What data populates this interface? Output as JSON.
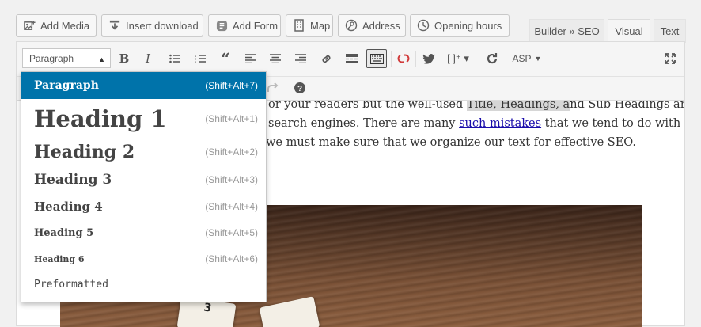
{
  "media_buttons": [
    {
      "label": "Add Media",
      "icon": "add-media-icon"
    },
    {
      "label": "Insert download",
      "icon": "download-icon"
    },
    {
      "label": "Add Form",
      "icon": "form-icon"
    },
    {
      "label": "Map",
      "icon": "map-icon"
    },
    {
      "label": "Address",
      "icon": "address-icon"
    },
    {
      "label": "Opening hours",
      "icon": "clock-icon"
    }
  ],
  "tabs": {
    "builder": "Builder » SEO",
    "visual": "Visual",
    "text": "Text"
  },
  "toolbar": {
    "format_select": "Paragraph",
    "asp_label": "ASP"
  },
  "content": {
    "line1_a": "or your readers but the well-used ",
    "line1_hl": "Title, Headings, a",
    "line1_b": "nd Sub Headings are",
    "line2_a": " search engines. There are many ",
    "line2_link": "such mistakes",
    "line2_b": " that we tend to do with",
    "line3": "we must make sure that we organize our text for effective SEO."
  },
  "photo": {
    "tile_a": "3"
  },
  "format_menu": [
    {
      "label": "Paragraph",
      "shortcut": "(Shift+Alt+7)",
      "active": true
    },
    {
      "label": "Heading 1",
      "shortcut": "(Shift+Alt+1)"
    },
    {
      "label": "Heading 2",
      "shortcut": "(Shift+Alt+2)"
    },
    {
      "label": "Heading 3",
      "shortcut": "(Shift+Alt+3)"
    },
    {
      "label": "Heading 4",
      "shortcut": "(Shift+Alt+4)"
    },
    {
      "label": "Heading 5",
      "shortcut": "(Shift+Alt+5)"
    },
    {
      "label": "Heading 6",
      "shortcut": "(Shift+Alt+6)"
    },
    {
      "label": "Preformatted",
      "shortcut": ""
    }
  ],
  "colors": {
    "accent": "#0073aa",
    "link": "#1a0dab",
    "highlight": "#d6d6d6"
  }
}
